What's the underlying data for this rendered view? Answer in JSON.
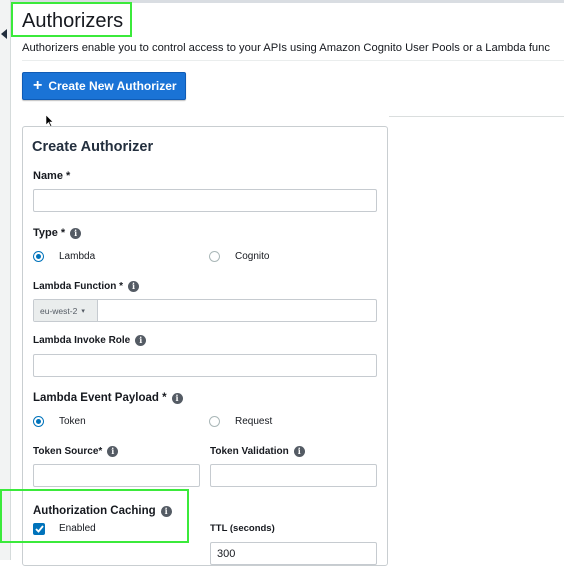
{
  "page": {
    "title": "Authorizers",
    "description": "Authorizers enable you to control access to your APIs using Amazon Cognito User Pools or a Lambda func",
    "create_button_label": "Create New Authorizer"
  },
  "form": {
    "title": "Create Authorizer",
    "name_label": "Name *",
    "name_value": "",
    "type_label": "Type *",
    "type_options": [
      "Lambda",
      "Cognito"
    ],
    "type_selected": "Lambda",
    "lambda_function_label": "Lambda Function *",
    "lambda_region": "eu-west-2",
    "lambda_function_value": "",
    "lambda_invoke_role_label": "Lambda Invoke Role",
    "lambda_invoke_role_value": "",
    "event_payload_label": "Lambda Event Payload *",
    "event_payload_options": [
      "Token",
      "Request"
    ],
    "event_payload_selected": "Token",
    "token_source_label": "Token Source*",
    "token_source_value": "",
    "token_validation_label": "Token Validation",
    "token_validation_value": "",
    "caching_label": "Authorization Caching",
    "caching_checkbox_label": "Enabled",
    "caching_enabled": true,
    "ttl_label": "TTL (seconds)",
    "ttl_value": "300"
  },
  "icons": {
    "info": "info-icon",
    "plus": "plus-icon",
    "collapse": "collapse-arrow-icon"
  },
  "colors": {
    "primary_button": "#1a73d6",
    "radio_selected": "#0073bb",
    "highlight_box": "#3bea3b"
  }
}
